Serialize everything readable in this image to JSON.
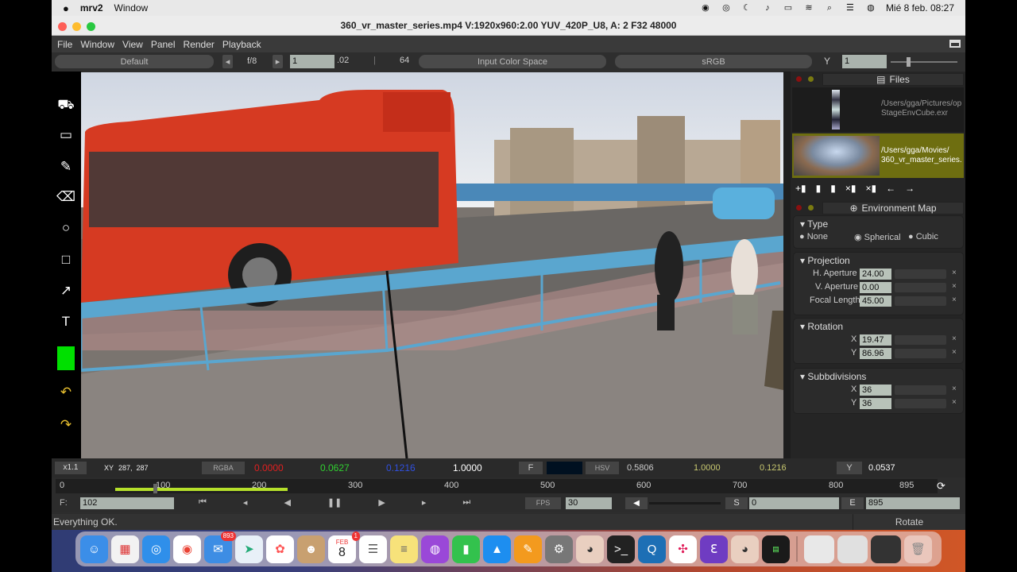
{
  "menubar": {
    "apple": "",
    "app": "mrv2",
    "window": "Window",
    "datetime": "Mié 8 feb.  08:27"
  },
  "window": {
    "title": "360_vr_master_series.mp4  V:1920x960:2.00 YUV_420P_U8, A: 2 F32 48000"
  },
  "menu": {
    "items": [
      "File",
      "Window",
      "View",
      "Panel",
      "Render",
      "Playback"
    ]
  },
  "toolbar": {
    "layer": "Default",
    "fstop": "f/8",
    "gain": "1",
    "gamma": ".02",
    "gamma_val": "64",
    "input_cs": "Input Color Space",
    "display": "sRGB",
    "channel": "Y",
    "y_val": "1"
  },
  "tools": [
    {
      "name": "scrub-icon",
      "glyph": "⛟"
    },
    {
      "name": "select-icon",
      "glyph": "▭"
    },
    {
      "name": "pencil-icon",
      "glyph": "✎"
    },
    {
      "name": "eraser-icon",
      "glyph": "⌫"
    },
    {
      "name": "circle-icon",
      "glyph": "○"
    },
    {
      "name": "rectangle-icon",
      "glyph": "□"
    },
    {
      "name": "arrow-icon",
      "glyph": "↗"
    },
    {
      "name": "text-icon",
      "glyph": "T"
    },
    {
      "name": "undo-icon",
      "glyph": "↶"
    },
    {
      "name": "redo-icon",
      "glyph": "↷"
    }
  ],
  "colors": {
    "draw_color": "#00e000",
    "file_selected": "#6e6e10",
    "accent": "#3d8fd1"
  },
  "files": {
    "header": "Files",
    "items": [
      {
        "path": "/Users/gga/Pictures/op\nStageEnvCube.exr"
      },
      {
        "path": "/Users/gga/Movies/\n360_vr_master_series."
      }
    ]
  },
  "env": {
    "header": "Environment Map",
    "type": {
      "label": "Type",
      "options": [
        "None",
        "Spherical",
        "Cubic"
      ],
      "selected": "Spherical"
    },
    "projection": {
      "label": "Projection",
      "h_label": "H. Aperture",
      "h": "24.00",
      "v_label": "V. Aperture",
      "v": "0.00",
      "f_label": "Focal Length",
      "f": "45.00"
    },
    "rotation": {
      "label": "Rotation",
      "x_label": "X",
      "x": "19.47",
      "y_label": "Y",
      "y": "86.96"
    },
    "subdiv": {
      "label": "Subbdivisions",
      "x_label": "X",
      "x": "36",
      "y_label": "Y",
      "y": "36"
    }
  },
  "pixelbar": {
    "zoom": "x1.1",
    "xy_label": "XY",
    "xy": "287,  287",
    "mode": "RGBA",
    "r": "0.0000",
    "g": "0.0627",
    "b": "0.1216",
    "a": "1.0000",
    "f": "F",
    "hsv": "HSV",
    "h": "0.5806",
    "s": "1.0000",
    "v": "0.1216",
    "y": "Y",
    "lum": "0.0537"
  },
  "timeline": {
    "ticks": [
      "0",
      "100",
      "200",
      "300",
      "400",
      "500",
      "600",
      "700",
      "800",
      "895"
    ],
    "frame_label": "F:",
    "frame": "102",
    "fps_label": "FPS",
    "fps": "30",
    "s_label": "S",
    "start": "0",
    "e_label": "E",
    "end": "895"
  },
  "status": {
    "message": "Everything OK.",
    "mode": "Rotate"
  },
  "dock": {
    "mail_badge": "893",
    "cal_badge": "1",
    "cal_month": "FEB",
    "cal_day": "8"
  }
}
